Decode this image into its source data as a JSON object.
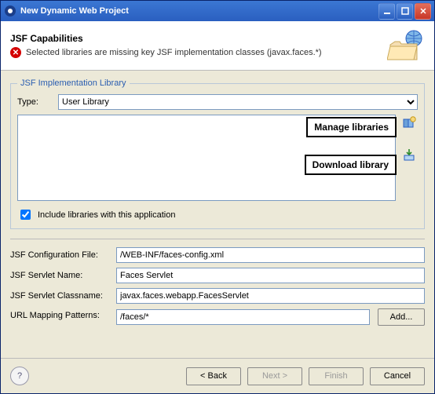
{
  "window": {
    "title": "New Dynamic Web Project"
  },
  "header": {
    "title": "JSF Capabilities",
    "error": "Selected libraries are missing key JSF implementation classes (javax.faces.*)"
  },
  "fieldset": {
    "legend": "JSF Implementation Library",
    "type_label": "Type:",
    "type_value": "User Library",
    "include_label": "Include libraries with this application"
  },
  "callouts": {
    "manage": "Manage libraries",
    "download": "Download library"
  },
  "form": {
    "config_label": "JSF Configuration File:",
    "config_value": "/WEB-INF/faces-config.xml",
    "servlet_name_label": "JSF Servlet Name:",
    "servlet_name_value": "Faces Servlet",
    "servlet_class_label": "JSF Servlet Classname:",
    "servlet_class_value": "javax.faces.webapp.FacesServlet",
    "url_label": "URL Mapping Patterns:",
    "url_value": "/faces/*",
    "add_label": "Add..."
  },
  "footer": {
    "back": "< Back",
    "next": "Next >",
    "finish": "Finish",
    "cancel": "Cancel"
  },
  "include_checked": true
}
